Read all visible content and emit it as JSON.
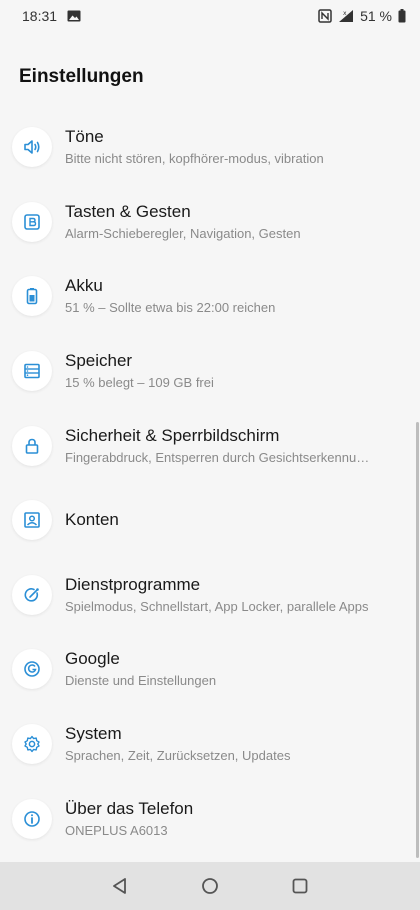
{
  "status_bar": {
    "time": "18:31",
    "battery_text": "51 %"
  },
  "page": {
    "title": "Einstellungen"
  },
  "colors": {
    "accent": "#2b8fd6",
    "background": "#f6f6f6",
    "nav_bar": "#e2e2e2"
  },
  "items": [
    {
      "title": "Töne",
      "subtitle": "Bitte nicht stören, kopfhörer-modus, vibration",
      "icon": "speaker-icon"
    },
    {
      "title": "Tasten & Gesten",
      "subtitle": "Alarm-Schieberegler, Navigation, Gesten",
      "icon": "button-b-icon"
    },
    {
      "title": "Akku",
      "subtitle": "51 % – Sollte etwa bis 22:00 reichen",
      "icon": "battery-icon"
    },
    {
      "title": "Speicher",
      "subtitle": "15 % belegt – 109 GB frei",
      "icon": "storage-icon"
    },
    {
      "title": "Sicherheit & Sperrbildschirm",
      "subtitle": "Fingerabdruck, Entsperren durch Gesichtserkennu…",
      "icon": "lock-icon"
    },
    {
      "title": "Konten",
      "subtitle": "",
      "icon": "account-icon"
    },
    {
      "title": "Dienstprogramme",
      "subtitle": "Spielmodus, Schnellstart, App Locker, parallele Apps",
      "icon": "utilities-icon"
    },
    {
      "title": "Google",
      "subtitle": "Dienste und Einstellungen",
      "icon": "google-icon"
    },
    {
      "title": "System",
      "subtitle": "Sprachen, Zeit, Zurücksetzen, Updates",
      "icon": "gear-icon"
    },
    {
      "title": "Über das Telefon",
      "subtitle": "ONEPLUS A6013",
      "icon": "info-icon"
    }
  ]
}
